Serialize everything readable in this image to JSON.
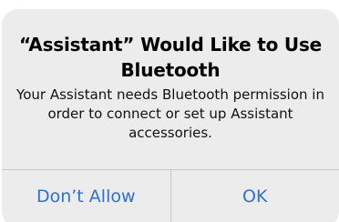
{
  "alert": {
    "title": "“Assistant” Would Like to Use Bluetooth",
    "message": "Your Assistant needs Bluetooth permission in order to connect or set up Assistant accessories.",
    "buttons": {
      "dont_allow": "Don’t Allow",
      "ok": "OK"
    }
  },
  "colors": {
    "alert_background": "#ececed",
    "button_text": "#2f6fd8",
    "separator": "#c7c7cc"
  }
}
